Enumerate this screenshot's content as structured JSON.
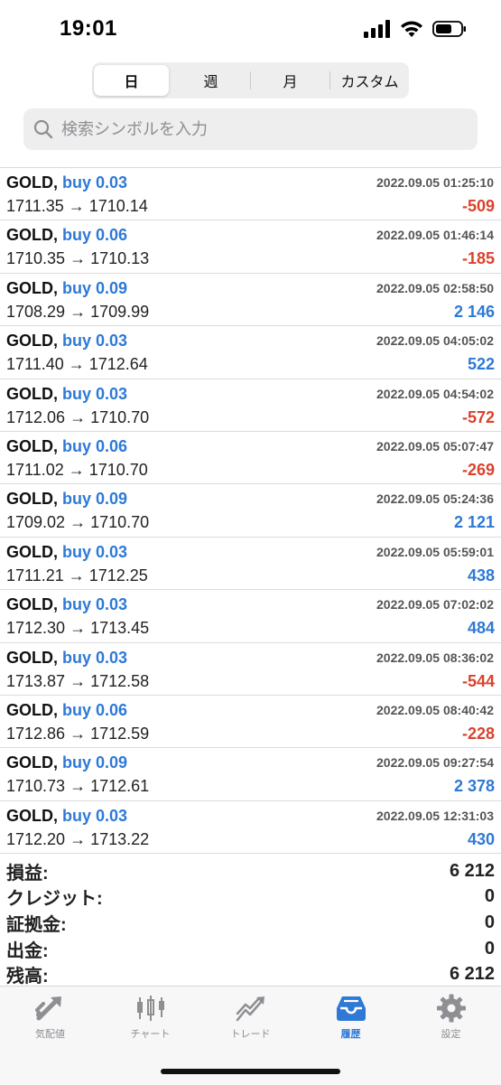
{
  "status": {
    "time": "19:01"
  },
  "segments": [
    {
      "label": "日",
      "active": true
    },
    {
      "label": "週",
      "active": false
    },
    {
      "label": "月",
      "active": false
    },
    {
      "label": "カスタム",
      "active": false
    }
  ],
  "search": {
    "placeholder": "検索シンボルを入力"
  },
  "trades": [
    {
      "symbol": "GOLD,",
      "side": "buy 0.03",
      "prices": "1711.35 → 1710.14",
      "time": "2022.09.05 01:25:10",
      "profit": "-509"
    },
    {
      "symbol": "GOLD,",
      "side": "buy 0.06",
      "prices": "1710.35 → 1710.13",
      "time": "2022.09.05 01:46:14",
      "profit": "-185"
    },
    {
      "symbol": "GOLD,",
      "side": "buy 0.09",
      "prices": "1708.29 → 1709.99",
      "time": "2022.09.05 02:58:50",
      "profit": "2 146"
    },
    {
      "symbol": "GOLD,",
      "side": "buy 0.03",
      "prices": "1711.40 → 1712.64",
      "time": "2022.09.05 04:05:02",
      "profit": "522"
    },
    {
      "symbol": "GOLD,",
      "side": "buy 0.03",
      "prices": "1712.06 → 1710.70",
      "time": "2022.09.05 04:54:02",
      "profit": "-572"
    },
    {
      "symbol": "GOLD,",
      "side": "buy 0.06",
      "prices": "1711.02 → 1710.70",
      "time": "2022.09.05 05:07:47",
      "profit": "-269"
    },
    {
      "symbol": "GOLD,",
      "side": "buy 0.09",
      "prices": "1709.02 → 1710.70",
      "time": "2022.09.05 05:24:36",
      "profit": "2 121"
    },
    {
      "symbol": "GOLD,",
      "side": "buy 0.03",
      "prices": "1711.21 → 1712.25",
      "time": "2022.09.05 05:59:01",
      "profit": "438"
    },
    {
      "symbol": "GOLD,",
      "side": "buy 0.03",
      "prices": "1712.30 → 1713.45",
      "time": "2022.09.05 07:02:02",
      "profit": "484"
    },
    {
      "symbol": "GOLD,",
      "side": "buy 0.03",
      "prices": "1713.87 → 1712.58",
      "time": "2022.09.05 08:36:02",
      "profit": "-544"
    },
    {
      "symbol": "GOLD,",
      "side": "buy 0.06",
      "prices": "1712.86 → 1712.59",
      "time": "2022.09.05 08:40:42",
      "profit": "-228"
    },
    {
      "symbol": "GOLD,",
      "side": "buy 0.09",
      "prices": "1710.73 → 1712.61",
      "time": "2022.09.05 09:27:54",
      "profit": "2 378"
    },
    {
      "symbol": "GOLD,",
      "side": "buy 0.03",
      "prices": "1712.20 → 1713.22",
      "time": "2022.09.05 12:31:03",
      "profit": "430"
    }
  ],
  "summary": [
    {
      "label": "損益:",
      "value": "6 212"
    },
    {
      "label": "クレジット:",
      "value": "0"
    },
    {
      "label": "証拠金:",
      "value": "0"
    },
    {
      "label": "出金:",
      "value": "0"
    },
    {
      "label": "残高:",
      "value": "6 212"
    }
  ],
  "tabs": [
    {
      "label": "気配値",
      "icon": "quotes-arrows-icon",
      "active": false
    },
    {
      "label": "チャート",
      "icon": "candlestick-chart-icon",
      "active": false
    },
    {
      "label": "トレード",
      "icon": "trade-line-icon",
      "active": false
    },
    {
      "label": "履歴",
      "icon": "history-inbox-icon",
      "active": true
    },
    {
      "label": "設定",
      "icon": "gear-icon",
      "active": false
    }
  ],
  "colors": {
    "accent": "#2e79d6",
    "loss": "#d9432e",
    "profit": "#2e79d6",
    "inactive": "#8e8e93"
  }
}
